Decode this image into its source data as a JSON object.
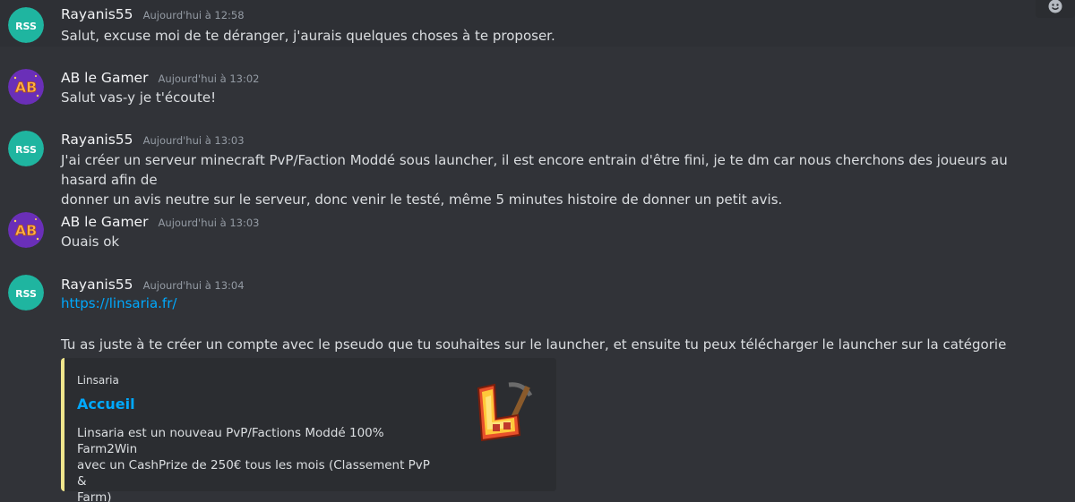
{
  "messages": [
    {
      "author": "Rayanis55",
      "timestamp": "Aujourd'hui à 12:58",
      "lines": [
        "Salut, excuse moi de te déranger, j'aurais quelques choses à te proposer."
      ]
    },
    {
      "author": "AB le Gamer",
      "timestamp": "Aujourd'hui à 13:02",
      "lines": [
        "Salut vas-y je t'écoute!"
      ]
    },
    {
      "author": "Rayanis55",
      "timestamp": "Aujourd'hui à 13:03",
      "lines": [
        "J'ai créer un serveur minecraft PvP/Faction Moddé sous launcher, il est encore entrain d'être fini, je te dm car nous cherchons des joueurs au hasard afin de",
        "donner un avis neutre sur le serveur, donc venir le testé, même 5 minutes histoire de donner un petit avis."
      ]
    },
    {
      "author": "AB le Gamer",
      "timestamp": "Aujourd'hui à 13:03",
      "lines": [
        "Ouais ok"
      ]
    },
    {
      "author": "Rayanis55",
      "timestamp": "Aujourd'hui à 13:04",
      "link": "https://linsaria.fr/",
      "lines": [
        "Tu as juste à te créer un compte avec le pseudo que tu souhaites sur le launcher, et ensuite tu peux télécharger le launcher sur la catégorie \"Jouer\""
      ]
    }
  ],
  "embed": {
    "provider": "Linsaria",
    "title": "Accueil",
    "description_lines": [
      "Linsaria est un nouveau PvP/Factions Moddé 100% Farm2Win",
      "avec un CashPrize de 250€ tous les mois (Classement PvP &",
      "Farm)"
    ],
    "accent_color": "#f0e68c"
  },
  "avatars": {
    "rayanis": {
      "label": "RSS",
      "bg": "#1fb5a0"
    },
    "ab": {
      "label": "AB",
      "bg": "#6a2fb8"
    }
  },
  "icons": {
    "reaction": "add-reaction-icon"
  },
  "colors": {
    "background": "#313338",
    "link": "#00a8fc",
    "username": "#f2f3f5",
    "timestamp": "#949ba4"
  }
}
